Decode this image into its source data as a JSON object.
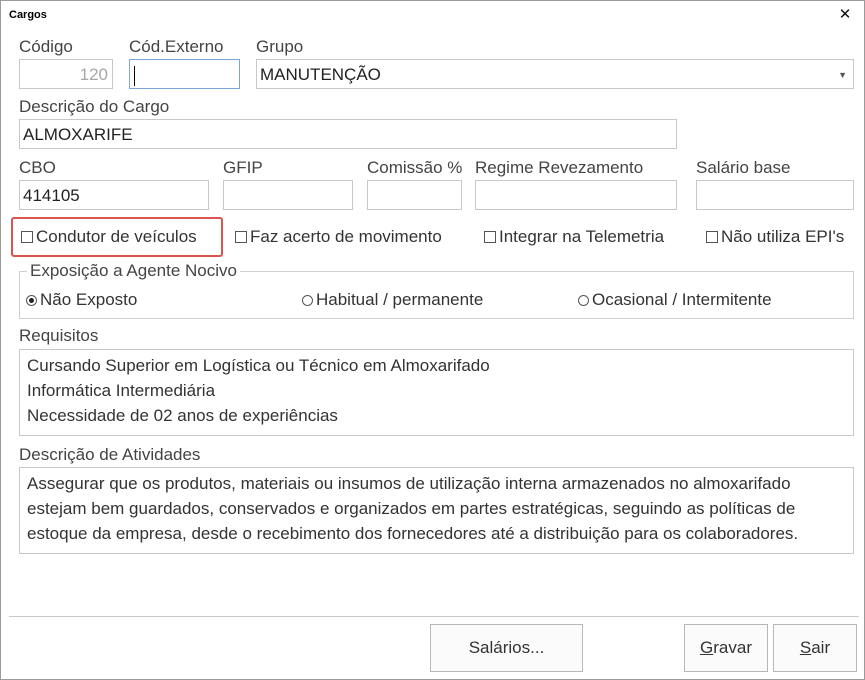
{
  "window": {
    "title": "Cargos"
  },
  "fields": {
    "codigo": {
      "label": "Código",
      "value": "120"
    },
    "cod_externo": {
      "label": "Cód.Externo",
      "value": ""
    },
    "grupo": {
      "label": "Grupo",
      "value": "MANUTENÇÃO"
    },
    "descricao": {
      "label": "Descrição do Cargo",
      "value": "ALMOXARIFE"
    },
    "cbo": {
      "label": "CBO",
      "value": "414105"
    },
    "gfip": {
      "label": "GFIP",
      "value": ""
    },
    "comissao": {
      "label": "Comissão %",
      "value": ""
    },
    "regime": {
      "label": "Regime Revezamento",
      "value": ""
    },
    "salario": {
      "label": "Salário base",
      "value": ""
    }
  },
  "checkboxes": [
    {
      "label": "Condutor de veículos",
      "checked": false
    },
    {
      "label": "Faz acerto de movimento",
      "checked": false
    },
    {
      "label": "Integrar na Telemetria",
      "checked": false
    },
    {
      "label": "Não utiliza EPI's",
      "checked": false
    }
  ],
  "exposicao": {
    "legend": "Exposição a Agente Nocivo",
    "options": [
      {
        "label": "Não Exposto",
        "selected": true
      },
      {
        "label": "Habitual / permanente",
        "selected": false
      },
      {
        "label": "Ocasional / Intermitente",
        "selected": false
      }
    ]
  },
  "requisitos": {
    "label": "Requisitos",
    "lines": [
      "Cursando Superior em Logística ou Técnico em Almoxarifado",
      "Informática Intermediária",
      "Necessidade de 02 anos de experiências"
    ]
  },
  "atividades": {
    "label": "Descrição de Atividades",
    "lines": [
      "Assegurar que os produtos, materiais ou insumos de utilização interna armazenados no almoxarifado",
      "estejam bem guardados, conservados e organizados em partes estratégicas, seguindo as políticas de",
      "estoque da empresa, desde o recebimento dos fornecedores até a distribuição para os colaboradores."
    ]
  },
  "buttons": {
    "salarios": "Salários...",
    "gravar_first": "G",
    "gravar_rest": "ravar",
    "sair_first": "S",
    "sair_rest": "air"
  },
  "colors": {
    "highlight": "#d9534f",
    "focus_border": "#7aa7d8"
  }
}
